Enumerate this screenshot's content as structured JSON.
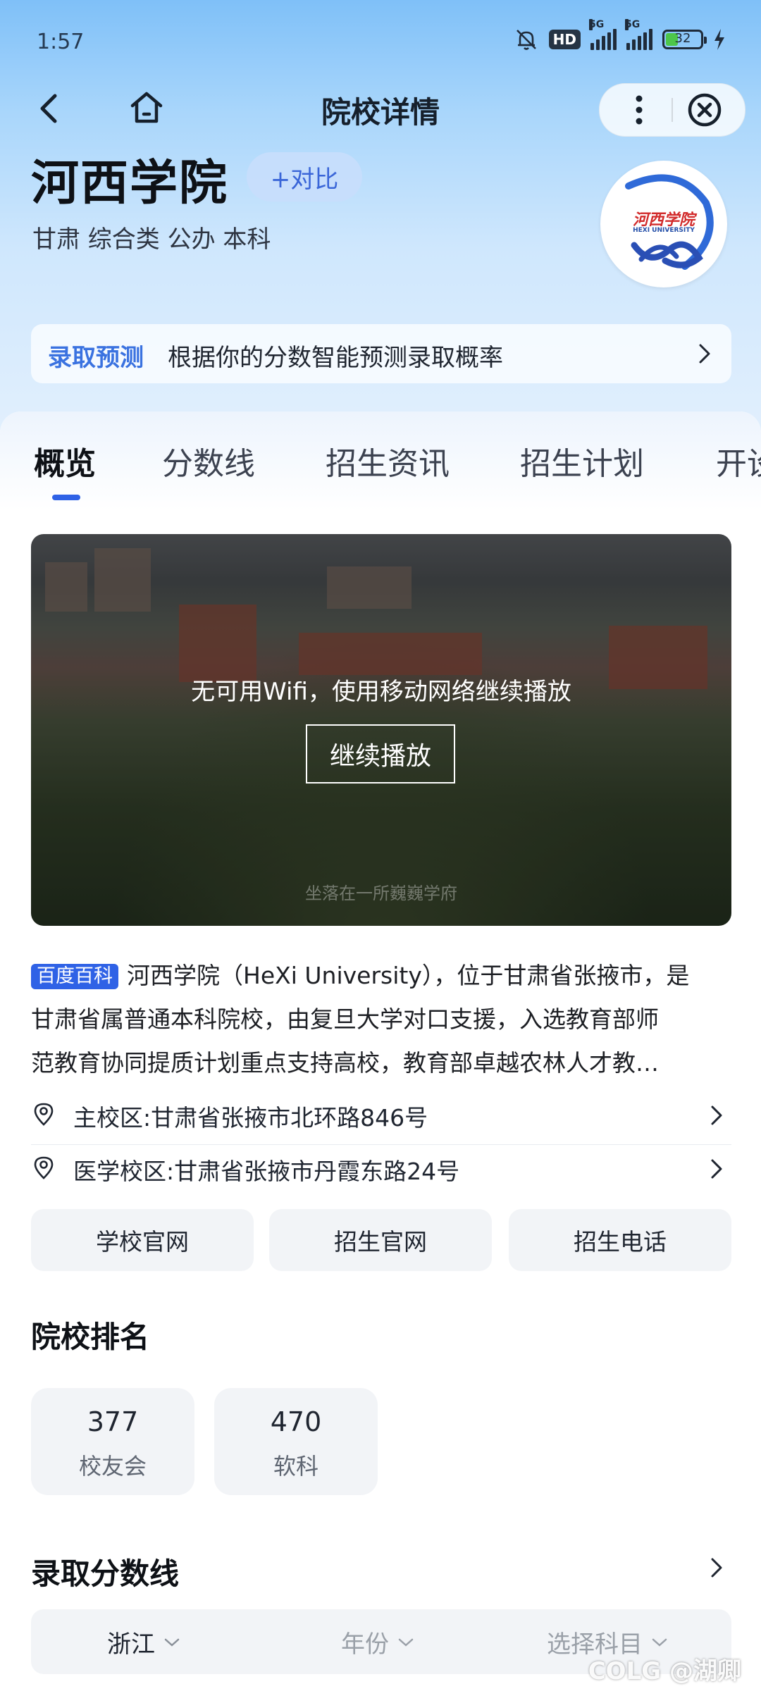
{
  "status_bar": {
    "time": "1:57",
    "hd_label": "HD",
    "net_label": "5G",
    "battery": "32",
    "battery_level": 0.32
  },
  "nav": {
    "title": "院校详情"
  },
  "school": {
    "name": "河西学院",
    "compare_label": "+对比",
    "tags": "甘肃 综合类 公办 本科",
    "logo_text": "河西学院",
    "logo_sub": "HEXI UNIVERSITY"
  },
  "predict": {
    "label": "录取预测",
    "text": "根据你的分数智能预测录取概率"
  },
  "tabs": [
    "概览",
    "分数线",
    "招生资讯",
    "招生计划",
    "开设专业"
  ],
  "video": {
    "message": "无可用Wifi，使用移动网络继续播放",
    "play_label": "继续播放",
    "caption": "坐落在一所巍巍学府"
  },
  "intro": {
    "badge": "百度百科",
    "line1": "河西学院（HeXi University），位于甘肃省张掖市，是",
    "line2": "甘肃省属普通本科院校，由复旦大学对口支援，入选教育部师",
    "line3": "范教育协同提质计划重点支持高校，教育部卓越农林人才教…"
  },
  "addresses": [
    {
      "text": "主校区:甘肃省张掖市北环路846号"
    },
    {
      "text": "医学校区:甘肃省张掖市丹霞东路24号"
    }
  ],
  "links": [
    "学校官网",
    "招生官网",
    "招生电话"
  ],
  "ranking": {
    "title": "院校排名",
    "items": [
      {
        "value": "377",
        "label": "校友会"
      },
      {
        "value": "470",
        "label": "软科"
      }
    ]
  },
  "scores": {
    "title": "录取分数线",
    "filters": [
      "浙江",
      "年份",
      "选择科目"
    ]
  },
  "watermark": "COLG @湖卿",
  "colors": {
    "accent": "#2f62e6",
    "predict_label": "#3a72e0",
    "compare_text": "#3a66d8"
  }
}
